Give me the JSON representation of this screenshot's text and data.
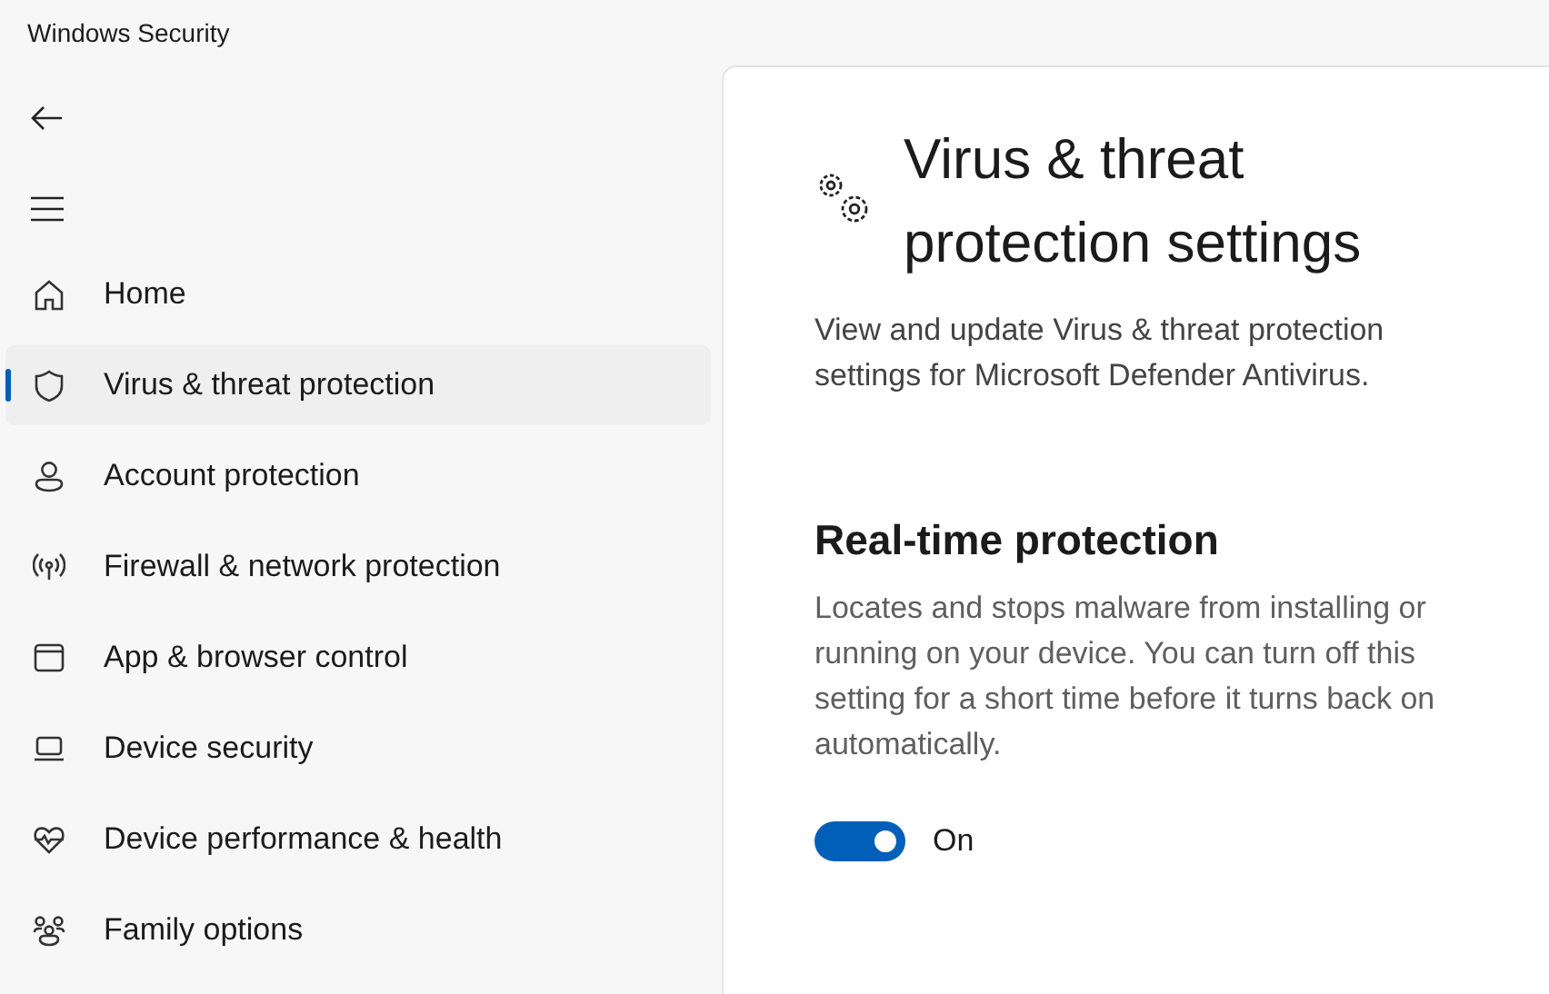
{
  "window": {
    "title": "Windows Security"
  },
  "sidebar": {
    "items": [
      {
        "label": "Home",
        "selected": false
      },
      {
        "label": "Virus & threat protection",
        "selected": true
      },
      {
        "label": "Account protection",
        "selected": false
      },
      {
        "label": "Firewall & network protection",
        "selected": false
      },
      {
        "label": "App & browser control",
        "selected": false
      },
      {
        "label": "Device security",
        "selected": false
      },
      {
        "label": "Device performance & health",
        "selected": false
      },
      {
        "label": "Family options",
        "selected": false
      }
    ]
  },
  "page": {
    "title": "Virus & threat protection settings",
    "description": "View and update Virus & threat protection settings for Microsoft Defender Antivirus.",
    "sections": [
      {
        "heading": "Real-time protection",
        "description": "Locates and stops malware from installing or running on your device. You can turn off this setting for a short time before it turns back on automatically.",
        "toggle": {
          "on": true,
          "label": "On"
        }
      }
    ]
  }
}
